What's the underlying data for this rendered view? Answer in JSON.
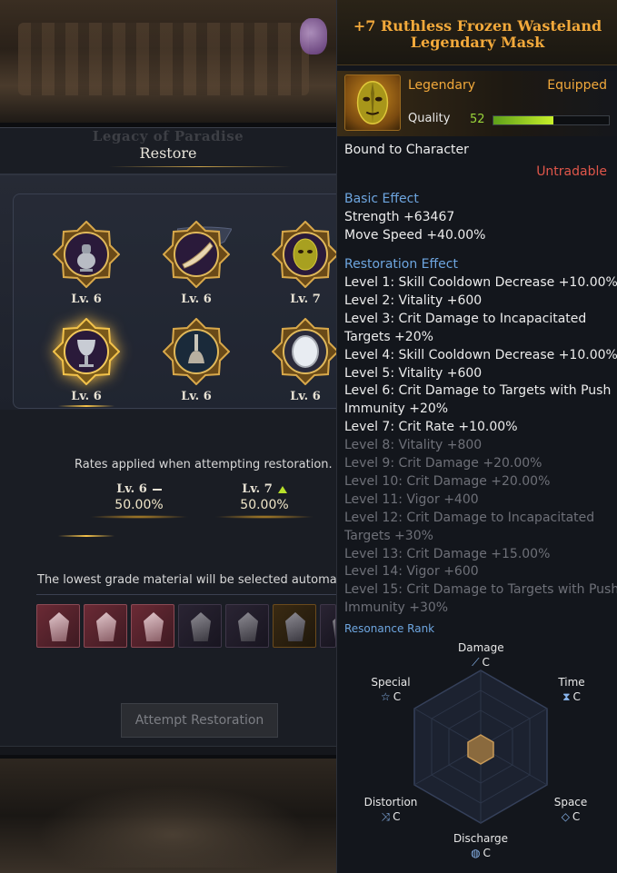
{
  "restore_panel": {
    "bg_title": "Legacy of Paradise",
    "title": "Restore",
    "slots": [
      {
        "level": "Lv. 6",
        "icon": "pot-icon",
        "selected": false
      },
      {
        "level": "Lv. 6",
        "icon": "horn-icon",
        "selected": false
      },
      {
        "level": "Lv. 7",
        "icon": "mask-icon",
        "selected": false
      },
      {
        "level": "Lv. 6",
        "icon": "chalice-icon",
        "selected": true
      },
      {
        "level": "Lv. 6",
        "icon": "bell-icon",
        "selected": false
      },
      {
        "level": "Lv. 6",
        "icon": "mirror-icon",
        "selected": false
      }
    ],
    "rates_text": "Rates applied when attempting restoration.",
    "rates": [
      {
        "level": "Lv. 6",
        "value": "50.00%",
        "indicator": "minus"
      },
      {
        "level": "Lv. 7",
        "value": "50.00%",
        "indicator": "up"
      }
    ],
    "material_text": "The lowest grade material will be selected automati",
    "materials": [
      "pink",
      "pink",
      "pink",
      "dark",
      "dark",
      "orange",
      "dark",
      "blue"
    ],
    "attempt_button": "Attempt Restoration"
  },
  "tooltip": {
    "title_line1": "+7 Ruthless Frozen Wasteland",
    "title_line2": "Legendary Mask",
    "grade": "Legendary",
    "equipped": "Equipped",
    "quality_label": "Quality",
    "quality_value": "52",
    "quality_fraction": 0.52,
    "bound": "Bound to Character",
    "untradable": "Untradable",
    "basic_effect_header": "Basic Effect",
    "basic_effects": [
      "Strength +63467",
      "Move Speed +40.00%"
    ],
    "restoration_header": "Restoration Effect",
    "restoration_lines": [
      {
        "text": "Level 1: Skill Cooldown Decrease +10.00%",
        "active": true
      },
      {
        "text": "Level 2: Vitality +600",
        "active": true
      },
      {
        "text": "Level 3: Crit Damage to Incapacitated",
        "active": true
      },
      {
        "text": "Targets +20%",
        "active": true
      },
      {
        "text": "Level 4: Skill Cooldown Decrease +10.00%",
        "active": true
      },
      {
        "text": "Level 5: Vitality +600",
        "active": true
      },
      {
        "text": "Level 6: Crit Damage to Targets with Push",
        "active": true
      },
      {
        "text": "Immunity +20%",
        "active": true
      },
      {
        "text": "Level 7: Crit Rate +10.00%",
        "active": true
      },
      {
        "text": "Level 8: Vitality +800",
        "active": false
      },
      {
        "text": "Level 9: Crit Damage +20.00%",
        "active": false
      },
      {
        "text": "Level 10: Crit Damage +20.00%",
        "active": false
      },
      {
        "text": "Level 11: Vigor +400",
        "active": false
      },
      {
        "text": "Level 12: Crit Damage to Incapacitated",
        "active": false
      },
      {
        "text": "Targets +30%",
        "active": false
      },
      {
        "text": "Level 13: Crit Damage +15.00%",
        "active": false
      },
      {
        "text": "Level 14: Vigor +600",
        "active": false
      },
      {
        "text": "Level 15: Crit Damage to Targets with Push",
        "active": false
      },
      {
        "text": "Immunity +30%",
        "active": false
      }
    ],
    "resonance_header": "Resonance Rank",
    "resonance": {
      "damage": {
        "label": "Damage",
        "grade": "C",
        "icon": "sword-icon"
      },
      "time": {
        "label": "Time",
        "grade": "C",
        "icon": "hourglass-icon"
      },
      "space": {
        "label": "Space",
        "grade": "C",
        "icon": "cube-icon"
      },
      "discharge": {
        "label": "Discharge",
        "grade": "C",
        "icon": "flame-icon"
      },
      "distortion": {
        "label": "Distortion",
        "grade": "C",
        "icon": "shuffle-icon"
      },
      "special": {
        "label": "Special",
        "grade": "C",
        "icon": "star-icon"
      }
    },
    "colors": {
      "legendary": "#f2a93b",
      "effect_header": "#6ea6e0",
      "untradable": "#e0564a",
      "quality": "#9ad63a"
    }
  }
}
